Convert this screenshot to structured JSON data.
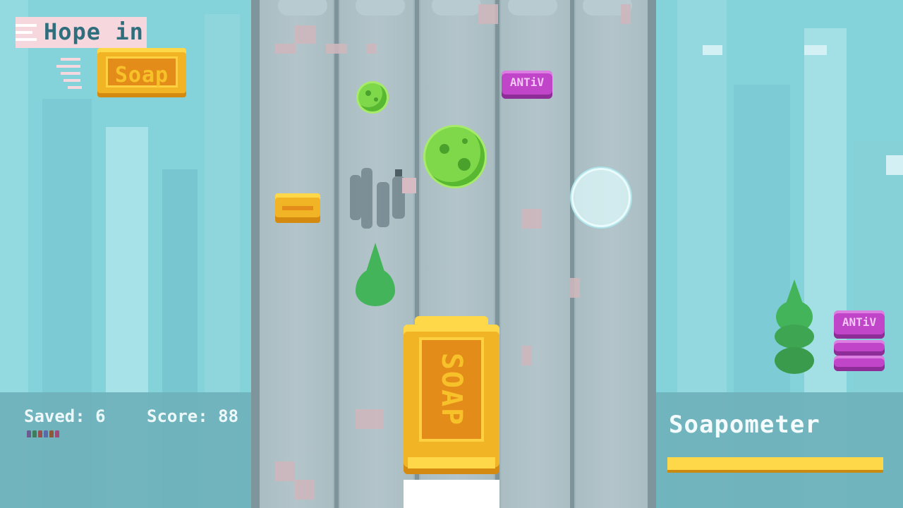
{
  "game": {
    "title_line1": "Hope in",
    "title_line2": "Soap"
  },
  "hud": {
    "saved_label": "Saved: 6",
    "score_label": "Score: 88",
    "saved_count": 6,
    "score": 88,
    "soapometer_label": "Soapometer",
    "soapometer_fill": 1.0
  },
  "items": {
    "antiv_label": "ANTiV",
    "player_label": "SOAP"
  },
  "colors": {
    "background": "#84d2da",
    "road": "#9fb3ba",
    "soap_gold": "#f0b424",
    "soap_orange": "#e48c1a",
    "antiv_purple": "#c145c9",
    "germ_green": "#7fd84a",
    "title_text": "#2f6e7c",
    "title_bg": "#f7d7de",
    "hud_panel": "#6fb1bb"
  },
  "icons": {
    "germ": "germ-icon",
    "bubble": "bubble-icon",
    "drop": "drop-icon",
    "gold_soap": "gold-soap-icon",
    "antiv": "antiv-icon",
    "person": "person-icon"
  }
}
